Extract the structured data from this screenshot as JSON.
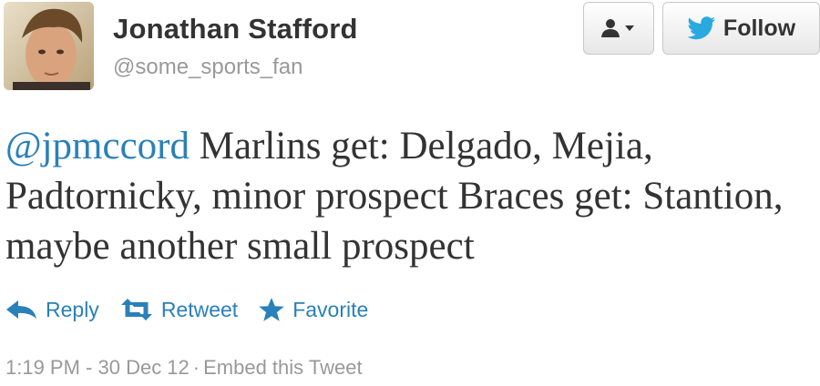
{
  "user": {
    "display_name": "Jonathan Stafford",
    "handle": "@some_sports_fan"
  },
  "buttons": {
    "follow_label": "Follow"
  },
  "tweet": {
    "mention": "@jpmccord",
    "text": " Marlins get: Delgado, Mejia, Padtornicky, minor prospect Braces get: Stantion, maybe another small prospect"
  },
  "actions": {
    "reply": "Reply",
    "retweet": "Retweet",
    "favorite": "Favorite"
  },
  "meta": {
    "timestamp": "1:19 PM - 30 Dec 12",
    "separator": "·",
    "embed": "Embed this Tweet"
  },
  "colors": {
    "link": "#2a80b9",
    "twitter_bird": "#2aa9e0",
    "muted": "#999999"
  },
  "icons": [
    "avatar-photo",
    "user-icon",
    "caret-down-icon",
    "twitter-bird-icon",
    "reply-icon",
    "retweet-icon",
    "star-icon"
  ]
}
